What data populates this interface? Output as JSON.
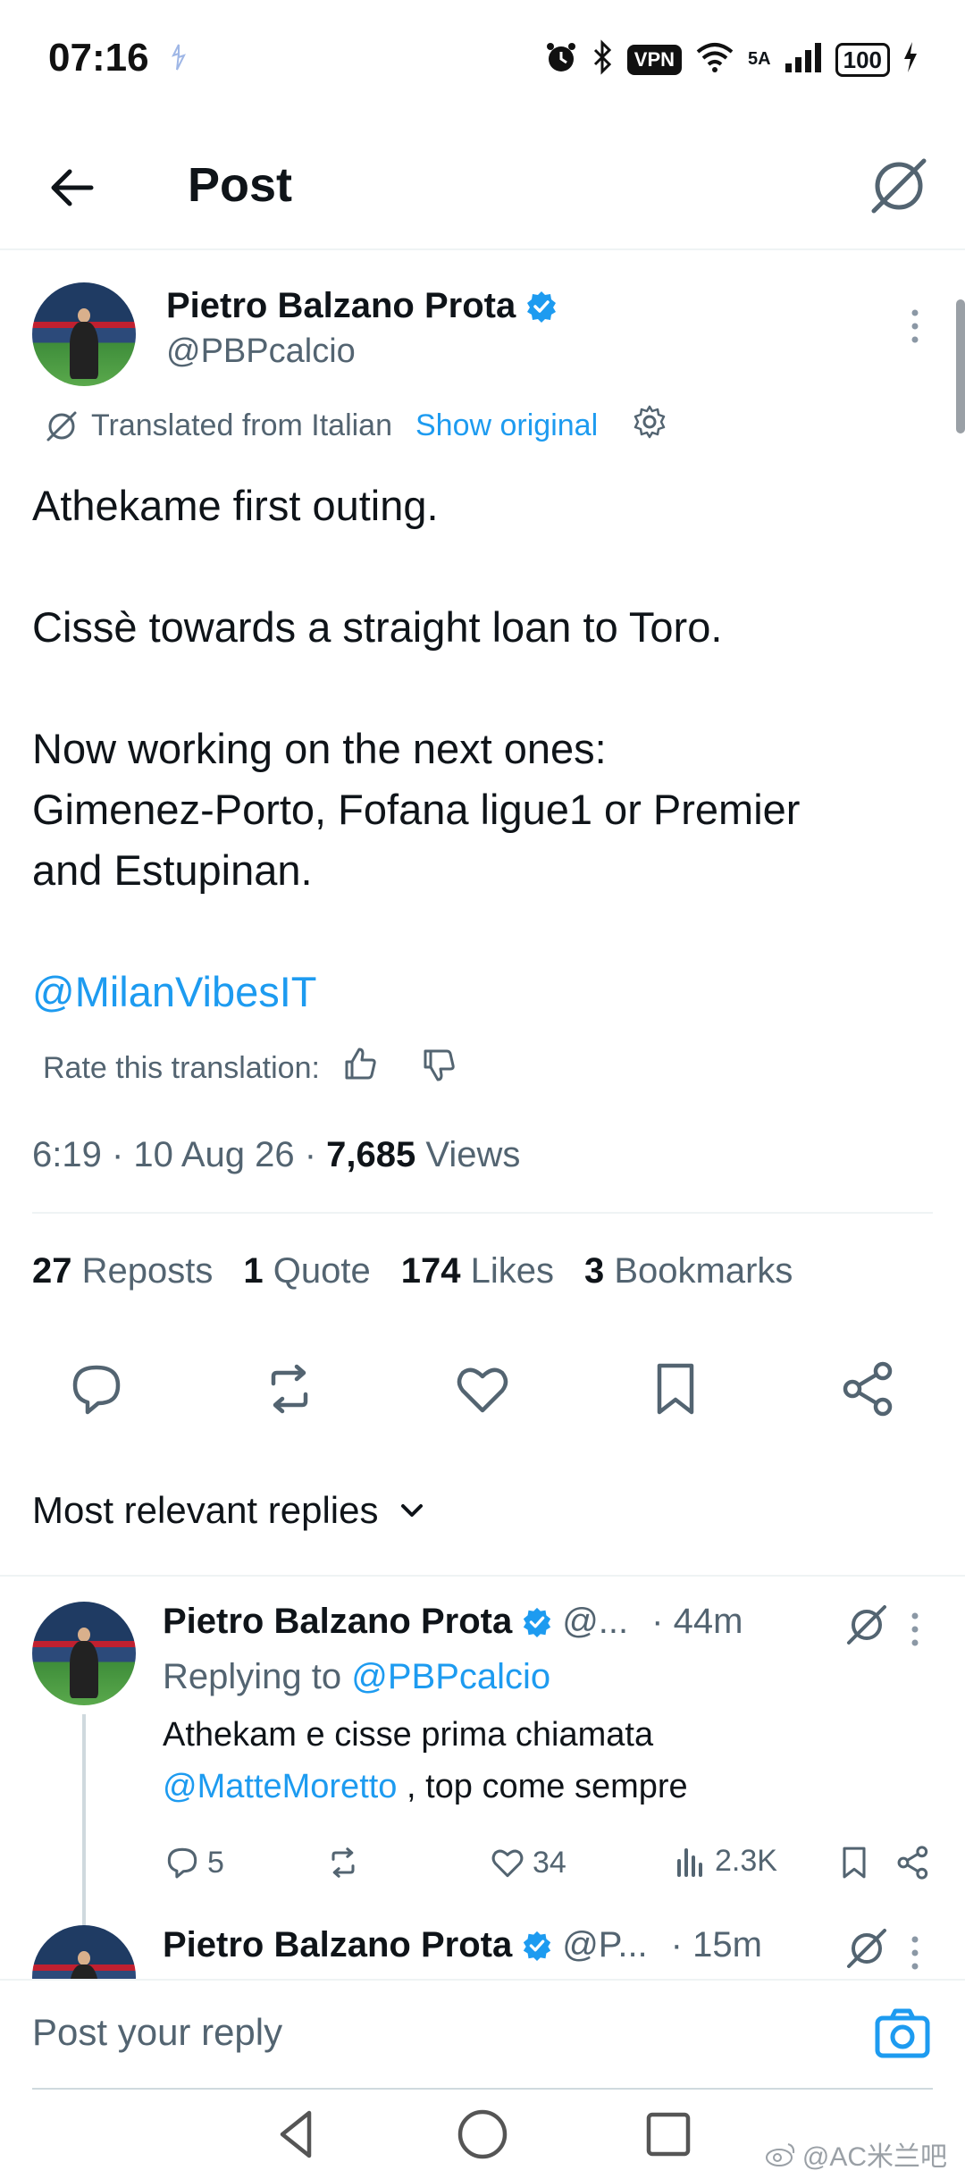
{
  "status_bar": {
    "time": "07:16",
    "vpn": "VPN",
    "network": "5A",
    "battery": "100"
  },
  "header": {
    "title": "Post"
  },
  "post": {
    "author_name": "Pietro Balzano Prota",
    "author_handle": "@PBPcalcio",
    "translated_label": "Translated from Italian",
    "show_original": "Show original",
    "body_lines": [
      "Athekame first outing.",
      "Cissè towards a straight loan to Toro.",
      "Now working on the next ones:",
      "Gimenez-Porto, Fofana ligue1 or Premier",
      "and Estupinan."
    ],
    "mention": "@MilanVibesIT",
    "rate_label": "Rate this translation:",
    "time": "6:19",
    "date": "10 Aug 26",
    "views_count": "7,685",
    "views_label": "Views",
    "stats": {
      "reposts_count": "27",
      "reposts_label": "Reposts",
      "quote_count": "1",
      "quote_label": "Quote",
      "likes_count": "174",
      "likes_label": "Likes",
      "bookmarks_count": "3",
      "bookmarks_label": "Bookmarks"
    }
  },
  "replies_header": {
    "label": "Most relevant replies"
  },
  "replies": [
    {
      "author_name": "Pietro Balzano Prota",
      "handle": "@...",
      "time": "· 44m",
      "replying_prefix": "Replying to",
      "replying_to": "@PBPcalcio",
      "text_line1": "Athekam e cisse prima chiamata",
      "text_mention": "@MatteMoretto",
      "text_line2_rest": " , top come sempre",
      "replies_count": "5",
      "likes_count": "34",
      "views_count": "2.3K"
    },
    {
      "author_name": "Pietro Balzano Prota",
      "handle": "@P...",
      "time": "· 15m"
    }
  ],
  "composer": {
    "placeholder": "Post your reply"
  },
  "watermark": "@AC米兰吧",
  "colors": {
    "accent": "#1d9bf0",
    "text": "#0f1419",
    "muted": "#536471",
    "verified": "#1d9bf0"
  }
}
